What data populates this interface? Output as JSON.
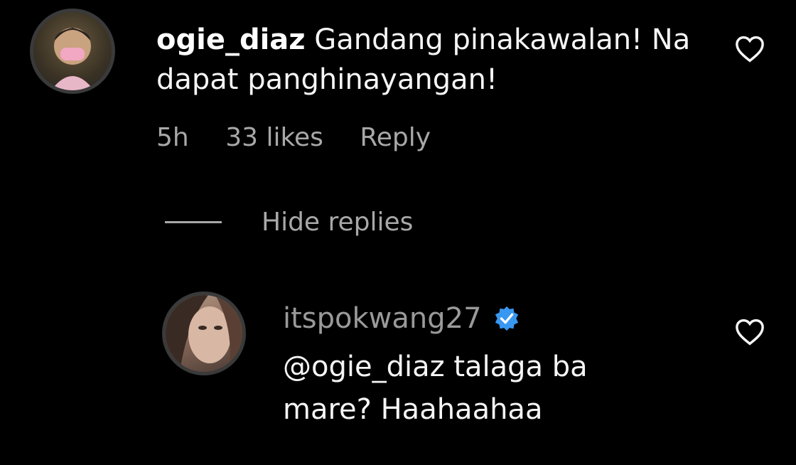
{
  "comment": {
    "username": "ogie_diaz",
    "text": "Gandang pinakawalan! Na dapat panghinayangan!",
    "time": "5h",
    "likes": "33 likes",
    "reply_label": "Reply",
    "like_icon": "heart-outline-icon"
  },
  "replies_toggle": {
    "label": "Hide replies"
  },
  "reply": {
    "username": "itspokwang27",
    "verified_icon": "verified-badge-icon",
    "text": "@ogie_diaz talaga ba mare? Haahaahaa",
    "like_icon": "heart-outline-icon"
  },
  "colors": {
    "background": "#000000",
    "primary_text": "#f5f5f5",
    "secondary_text": "#a8a8a8",
    "verified_blue": "#3897f0"
  }
}
